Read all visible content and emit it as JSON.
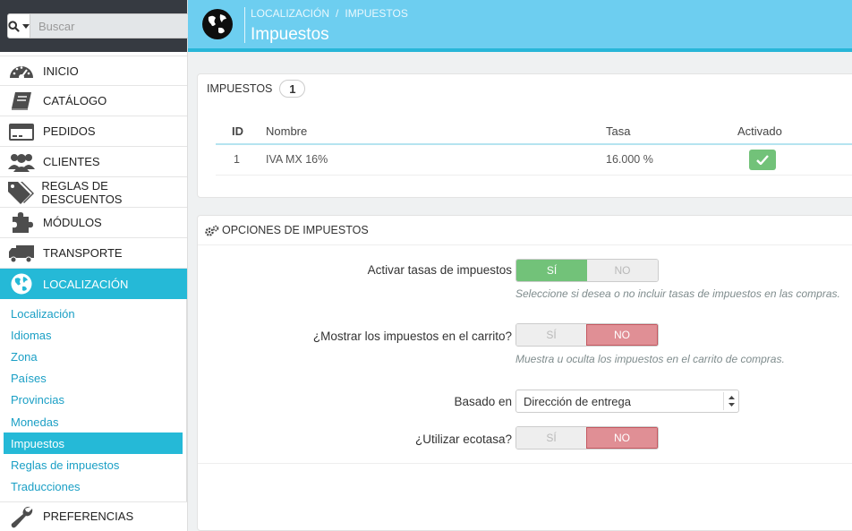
{
  "search": {
    "placeholder": "Buscar"
  },
  "sidebar": {
    "items": [
      {
        "label": "INICIO",
        "icon": "dashboard-icon"
      },
      {
        "label": "CATÁLOGO",
        "icon": "book-icon"
      },
      {
        "label": "PEDIDOS",
        "icon": "credit-card-icon"
      },
      {
        "label": "CLIENTES",
        "icon": "users-icon"
      },
      {
        "label": "REGLAS DE DESCUENTOS",
        "icon": "tags-icon"
      },
      {
        "label": "MÓDULOS",
        "icon": "puzzle-icon"
      },
      {
        "label": "TRANSPORTE",
        "icon": "truck-icon"
      },
      {
        "label": "LOCALIZACIÓN",
        "icon": "globe-icon",
        "active": true
      }
    ],
    "submenu": [
      "Localización",
      "Idiomas",
      "Zona",
      "Países",
      "Provincias",
      "Monedas",
      "Impuestos",
      "Reglas de impuestos",
      "Traducciones"
    ],
    "submenu_active": "Impuestos",
    "after": {
      "label": "PREFERENCIAS",
      "icon": "wrench-icon"
    }
  },
  "header": {
    "breadcrumb": [
      "LOCALIZACIÓN",
      "IMPUESTOS"
    ],
    "breadcrumb_sep": "/",
    "title": "Impuestos"
  },
  "taxes_panel": {
    "title": "IMPUESTOS",
    "count": "1",
    "columns": {
      "id": "ID",
      "name": "Nombre",
      "rate": "Tasa",
      "enabled": "Activado"
    },
    "rows": [
      {
        "id": "1",
        "name": "IVA MX 16%",
        "rate": "16.000 %",
        "enabled": true
      }
    ]
  },
  "options_panel": {
    "title": "OPCIONES DE IMPUESTOS",
    "enable_rates": {
      "label": "Activar tasas de impuestos",
      "yes": "SÍ",
      "no": "NO",
      "value": "yes",
      "help": "Seleccione si desea o no incluir tasas de impuestos en las compras."
    },
    "show_in_cart": {
      "label": "¿Mostrar los impuestos en el carrito?",
      "yes": "SÍ",
      "no": "NO",
      "value": "no",
      "help": "Muestra u oculta los impuestos en el carrito de compras."
    },
    "based_on": {
      "label": "Basado en",
      "value": "Dirección de entrega"
    },
    "ecotax": {
      "label": "¿Utilizar ecotasa?",
      "yes": "SÍ",
      "no": "NO",
      "value": "no"
    }
  },
  "colors": {
    "accent": "#25b9d7",
    "header_bg": "#6dcef0",
    "success": "#72c279",
    "danger": "#e08f95"
  }
}
